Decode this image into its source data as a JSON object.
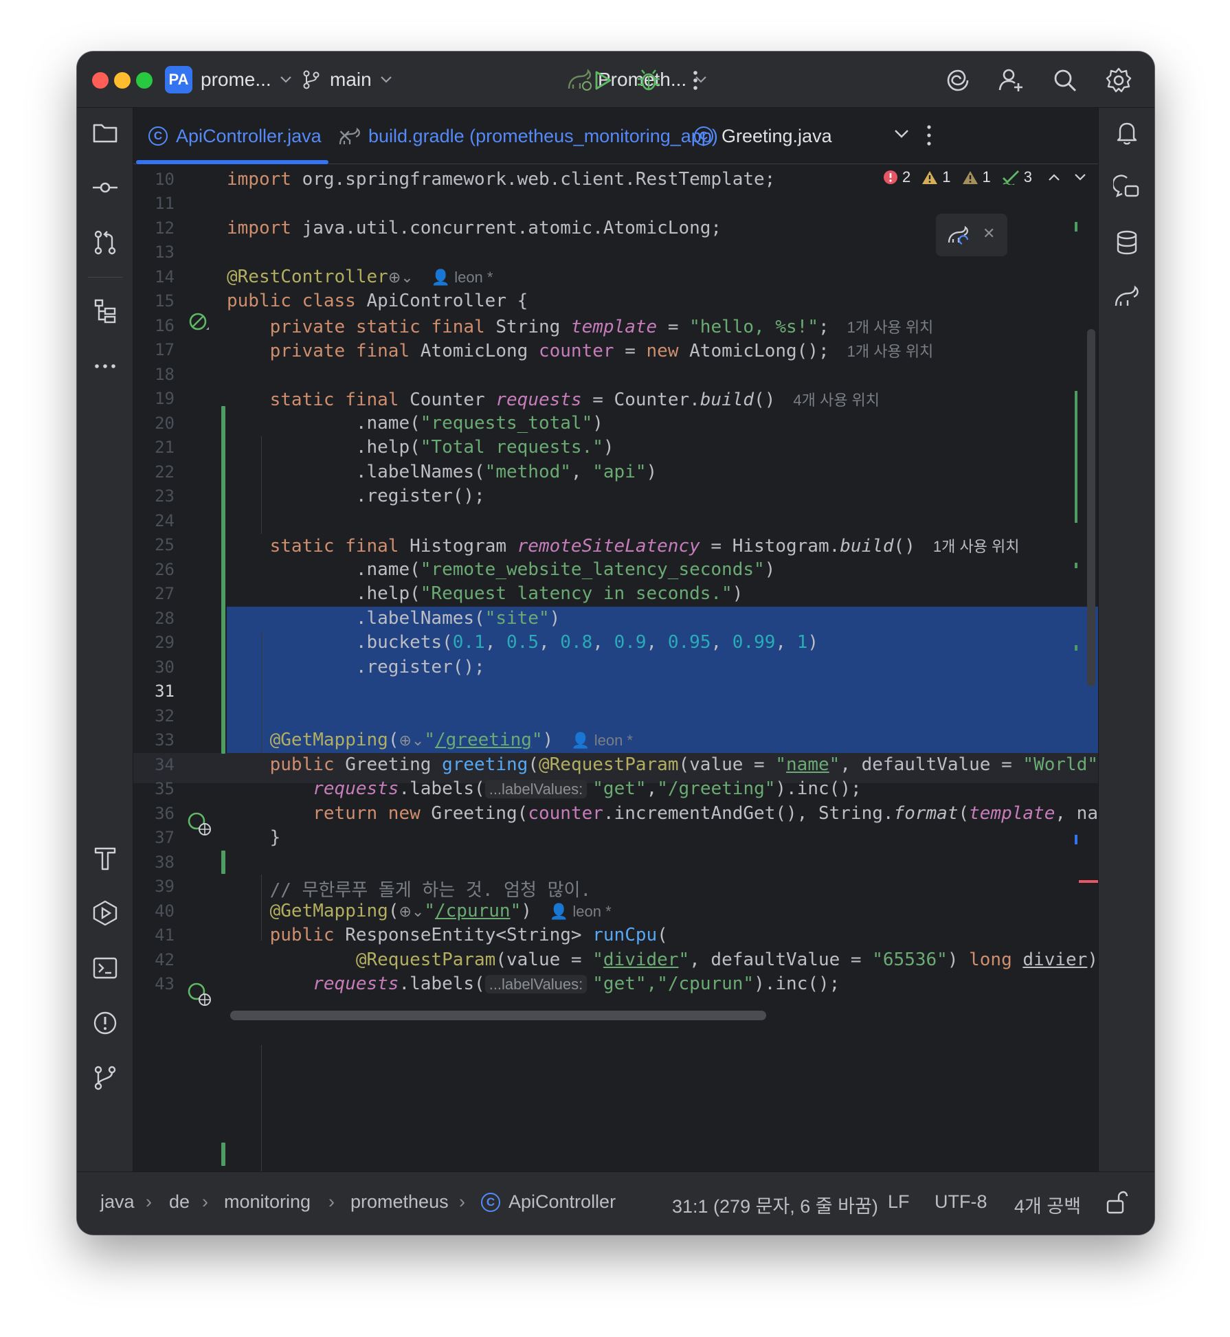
{
  "titlebar": {
    "project_badge": "PA",
    "project_name": "prome...",
    "branch": "main",
    "run_config": "Prometh..."
  },
  "tabs": [
    {
      "label": "ApiController.java",
      "active": true
    },
    {
      "label": "build.gradle (prometheus_monitoring_app)",
      "active": false
    },
    {
      "label": "Greeting.java",
      "active": false
    }
  ],
  "inspections": {
    "errors": "2",
    "warnings": "1",
    "weak_warnings": "1",
    "ok": "3"
  },
  "hints": {
    "usage1": "1개 사용 위치",
    "usage4": "4개 사용 위치",
    "author": "leon *",
    "labelValues": "...labelValues:"
  },
  "lines": {
    "l10_kw": "import",
    "l10": " org.springframework.web.client.RestTemplate;",
    "l12_kw": "import",
    "l12": " java.util.concurrent.atomic.AtomicLong;",
    "l14": "@RestController",
    "l15_kw": "public class",
    "l15": " ApiController {",
    "l16_kw": "private static final",
    "l16_t": " String ",
    "l16_f": "template",
    "l16_eq": " = ",
    "l16_s": "\"hello, %s!\"",
    "l16_end": ";",
    "l17_kw": "private final",
    "l17_t": " AtomicLong ",
    "l17_f": "counter",
    "l17_eq": " = ",
    "l17_kw2": "new",
    "l17_end": " AtomicLong();",
    "l19_kw": "static final",
    "l19_t": " Counter ",
    "l19_f": "requests",
    "l19_eq": " = Counter.",
    "l19_m": "build",
    "l19_end": "()",
    "l20": ".name(",
    "l20_s": "\"requests_total\"",
    "l20_end": ")",
    "l21": ".help(",
    "l21_s": "\"Total requests.\"",
    "l21_end": ")",
    "l22": ".labelNames(",
    "l22_s1": "\"method\"",
    "l22_c": ", ",
    "l22_s2": "\"api\"",
    "l22_end": ")",
    "l23": ".register();",
    "l25_kw": "static final",
    "l25_t": " Histogram ",
    "l25_f": "remoteSiteLatency",
    "l25_eq": " = Histogram.",
    "l25_m": "build",
    "l25_end": "()",
    "l26": ".name(",
    "l26_s": "\"remote_website_latency_seconds\"",
    "l26_end": ")",
    "l27": ".help(",
    "l27_s": "\"Request latency in seconds.\"",
    "l27_end": ")",
    "l28": ".labelNames(",
    "l28_s": "\"site\"",
    "l28_end": ")",
    "l29": ".buckets(",
    "l29_n1": "0.1",
    "l29_n2": "0.5",
    "l29_n3": "0.8",
    "l29_n4": "0.9",
    "l29_n5": "0.95",
    "l29_n6": "0.99",
    "l29_n7": "1",
    "l29_end": ")",
    "l30": ".register();",
    "l33_a": "@GetMapping",
    "l33_p": "(",
    "l33_s1": "\"",
    "l33_s2": "/greeting",
    "l33_s3": "\"",
    "l33_end": ")",
    "l34_kw": "public",
    "l34_t": " Greeting ",
    "l34_m": "greeting",
    "l34_p": "(",
    "l34_a": "@RequestParam",
    "l34_v": "(value = ",
    "l34_s1a": "\"",
    "l34_s1b": "name",
    "l34_s1c": "\"",
    "l34_d": ", defaultValue = ",
    "l34_s2": "\"World\"",
    "l34_end": ")",
    "l35_f": "requests",
    "l35": ".labels(",
    "l35_s1": "\"get\"",
    "l35_c": ",",
    "l35_s2": "\"/greeting\"",
    "l35_end": ").inc();",
    "l36_kw": "return new",
    "l36_t": " Greeting(",
    "l36_f": "counter",
    "l36_m": ".incrementAndGet(), String.",
    "l36_fm": "format",
    "l36_p": "(",
    "l36_tf": "template",
    "l36_end": ", nar",
    "l37": "}",
    "l39": "// 무한루푸 돌게 하는 것. 엄청 많이.",
    "l40_a": "@GetMapping",
    "l40_p": "(",
    "l40_s1": "\"",
    "l40_s2": "/cpurun",
    "l40_s3": "\"",
    "l40_end": ")",
    "l41_kw": "public",
    "l41_t": " ResponseEntity<String> ",
    "l41_m": "runCpu",
    "l41_end": "(",
    "l42_a": "@RequestParam",
    "l42_v": "(value = ",
    "l42_s1a": "\"",
    "l42_s1b": "divider",
    "l42_s1c": "\"",
    "l42_d": ", defaultValue = ",
    "l42_s2": "\"65536\"",
    "l42_p": ") ",
    "l42_kw": "long",
    "l42_sp": " ",
    "l42_var": "divier",
    "l42_end": ")·",
    "l43_f": "requests",
    "l43": ".labels(",
    "l43_s": "\"get\",\"/cpurun\"",
    "l43_end": ").inc();"
  },
  "line_numbers": [
    "10",
    "11",
    "12",
    "13",
    "14",
    "15",
    "16",
    "17",
    "18",
    "19",
    "20",
    "21",
    "22",
    "23",
    "24",
    "25",
    "26",
    "27",
    "28",
    "29",
    "30",
    "31",
    "32",
    "33",
    "34",
    "35",
    "36",
    "37",
    "38",
    "39",
    "40",
    "41",
    "42",
    "43"
  ],
  "status": {
    "crumbs": [
      "java",
      "de",
      "monitoring",
      "prometheus",
      "ApiController"
    ],
    "position": "31:1 (279 문자, 6 줄 바꿈)",
    "line_sep": "LF",
    "encoding": "UTF-8",
    "indent": "4개 공백"
  },
  "colors": {
    "accent": "#3574f0",
    "selection": "#214283",
    "keyword": "#cf8e6d",
    "string": "#6aab73",
    "number": "#2aacb8",
    "field": "#c77dbb"
  }
}
